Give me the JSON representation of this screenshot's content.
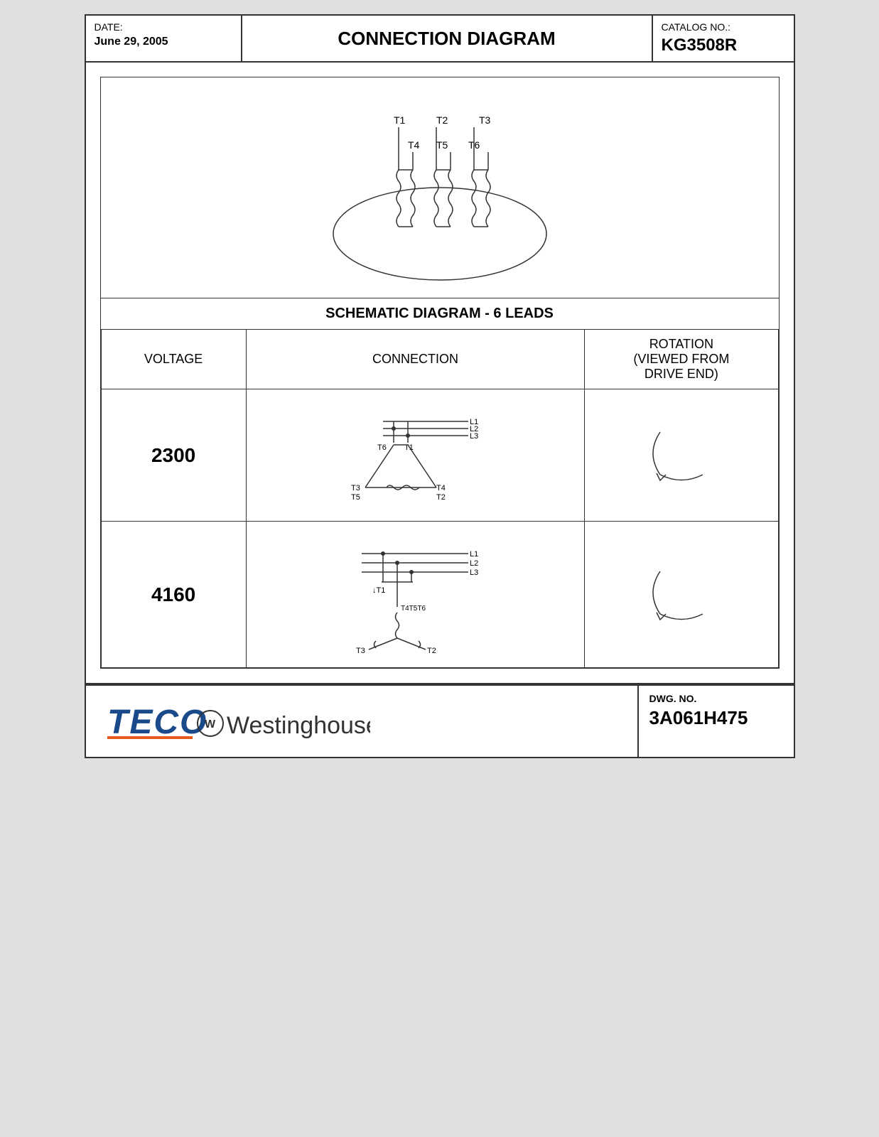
{
  "header": {
    "date_label": "DATE:",
    "date_value": "June 29, 2005",
    "title": "CONNECTION DIAGRAM",
    "catalog_label": "CATALOG NO.:",
    "catalog_value": "KG3508R"
  },
  "schematic": {
    "title": "SCHEMATIC DIAGRAM - 6 LEADS"
  },
  "table": {
    "col1_header": "VOLTAGE",
    "col2_header": "CONNECTION",
    "col3_header": "ROTATION\n(VIEWED FROM\nDRIVE END)",
    "row1_voltage": "2300",
    "row2_voltage": "4160"
  },
  "footer": {
    "dwg_label": "DWG. NO.",
    "dwg_value": "3A061H475",
    "logo_teco": "TECO",
    "logo_west": "Westinghouse"
  }
}
